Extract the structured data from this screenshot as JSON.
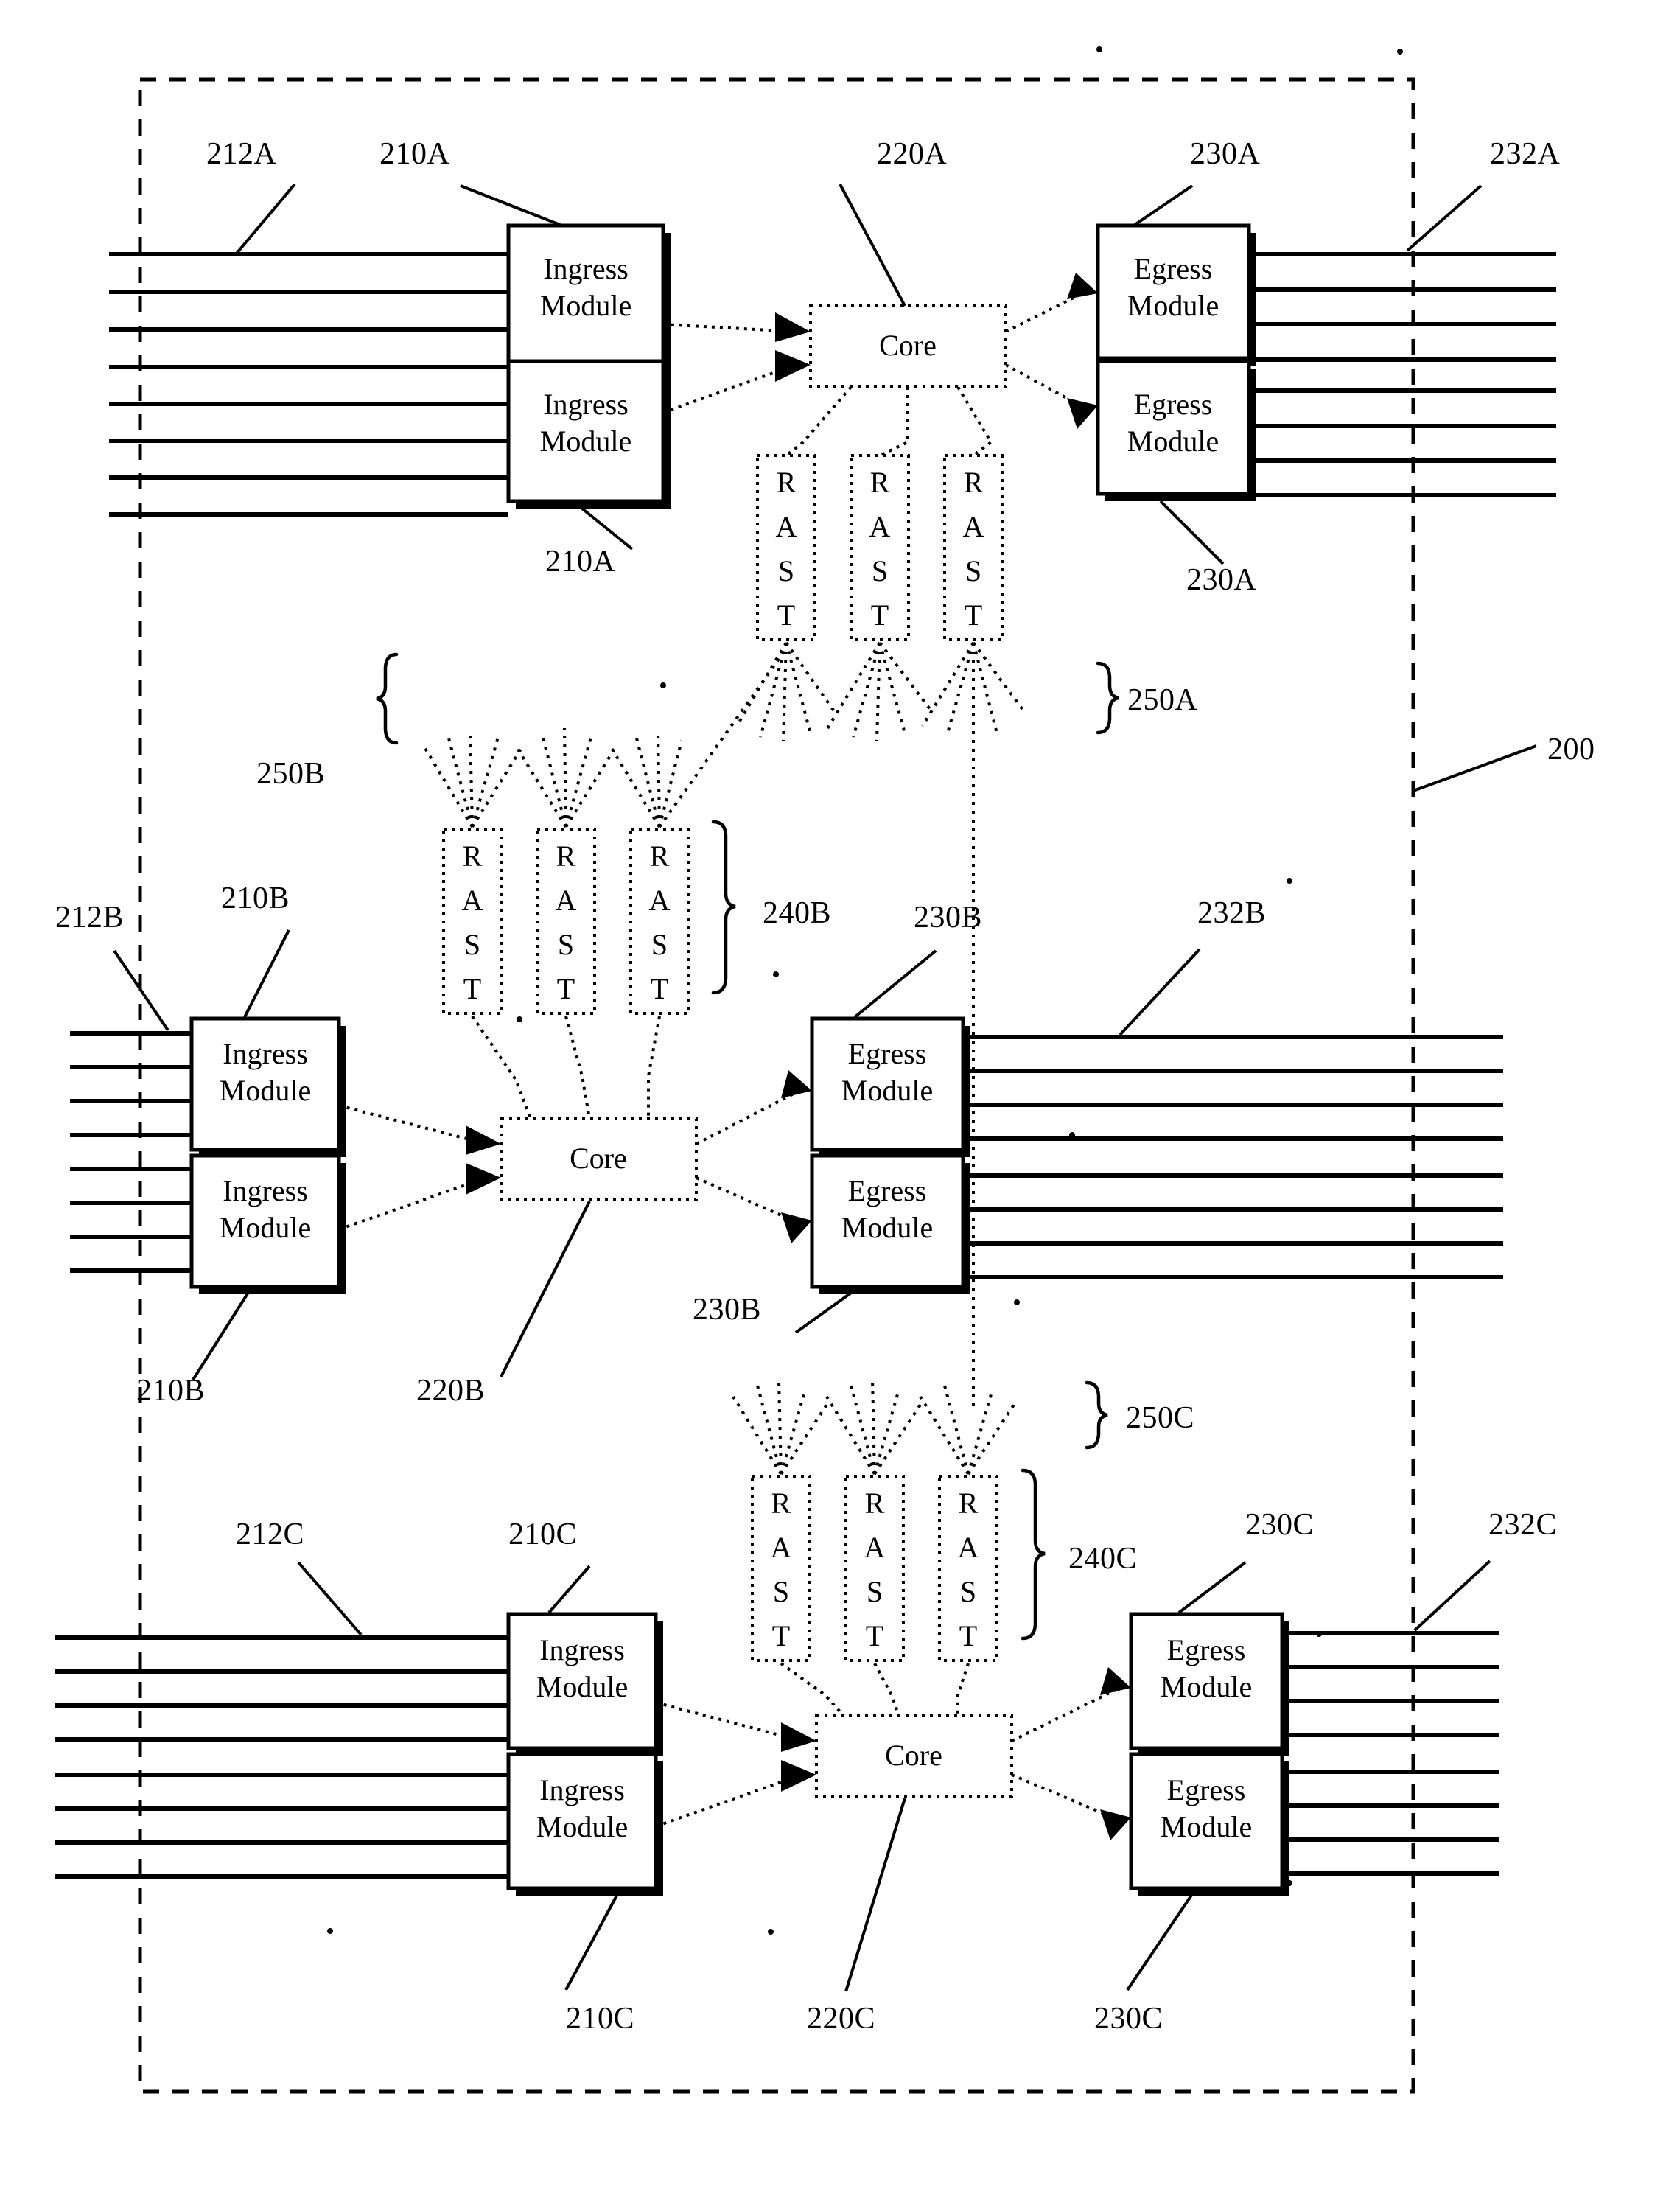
{
  "figure": {
    "overall_ref": "200",
    "block_labels": {
      "ingress": "Ingress\nModule",
      "ingress_line1": "Ingress",
      "ingress_line2": "Module",
      "egress_line1": "Egress",
      "egress_line2": "Module",
      "core": "Core",
      "rast_letters": [
        "R",
        "A",
        "S",
        "T"
      ]
    },
    "sections": [
      {
        "id": "A",
        "refs": {
          "ingress_top": "210A",
          "ingress_bottom": "210A",
          "input_lines": "212A",
          "core": "220A",
          "egress_top": "230A",
          "egress_bottom": "230A",
          "output_lines": "232A",
          "rast_group": "250A"
        },
        "rast_count": 3
      },
      {
        "id": "B",
        "refs": {
          "ingress_top": "210B",
          "ingress_bottom": "210B",
          "input_lines": "212B",
          "core": "220B",
          "egress_top": "230B",
          "egress_bottom": "230B",
          "output_lines": "232B",
          "rast_group": "240B",
          "fan_group": "250B"
        },
        "rast_count": 3
      },
      {
        "id": "C",
        "refs": {
          "ingress_top": "210C",
          "ingress_bottom": "210C",
          "input_lines": "212C",
          "core": "220C",
          "egress_top": "230C",
          "egress_bottom": "230C",
          "output_lines": "232C",
          "rast_group": "240C",
          "fan_group": "250C"
        },
        "rast_count": 3
      }
    ],
    "all_reference_numerals": [
      "212A",
      "210A",
      "220A",
      "230A",
      "232A",
      "210A",
      "230A",
      "250A",
      "200",
      "250B",
      "212B",
      "210B",
      "240B",
      "230B",
      "232B",
      "210B",
      "220B",
      "230B",
      "250C",
      "212C",
      "210C",
      "240C",
      "230C",
      "232C",
      "210C",
      "220C",
      "230C"
    ],
    "colors": {
      "ink": "#000000",
      "paper": "#ffffff"
    }
  }
}
